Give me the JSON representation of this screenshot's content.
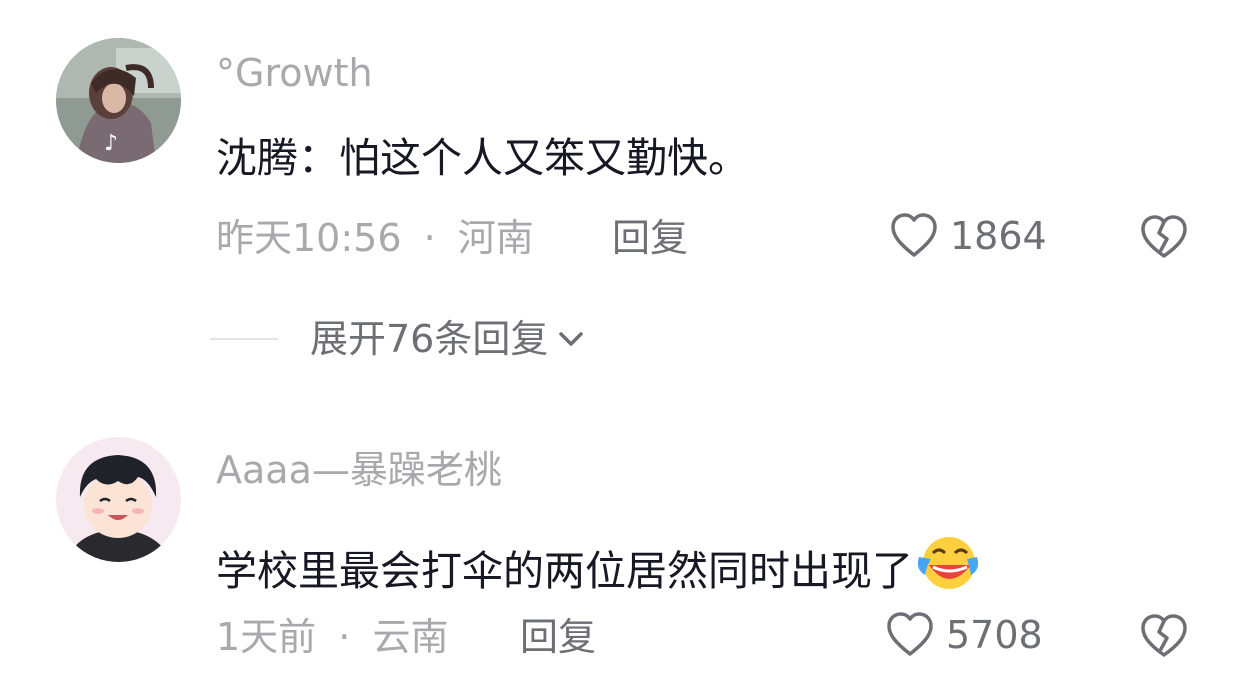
{
  "comments": [
    {
      "username": "°Growth",
      "text": "沈腾：怕这个人又笨又勤快。",
      "time": "昨天10:56",
      "separator": "·",
      "location": "河南",
      "reply_label": "回复",
      "likes": "1864",
      "expand_label": "展开76条回复"
    },
    {
      "username": "Aaaa—暴躁老桃",
      "text": "学校里最会打伞的两位居然同时出现了",
      "emoji_name": "laughing-crying-emoji",
      "time": "1天前",
      "separator": "·",
      "location": "云南",
      "reply_label": "回复",
      "likes": "5708"
    }
  ],
  "icons": {
    "like": "heart-outline-icon",
    "dislike": "broken-heart-icon",
    "expand": "chevron-down-icon"
  },
  "colors": {
    "primary_text": "#161823",
    "secondary_text": "#a9a9ad",
    "action_text": "#6e6f75",
    "icon": "#6e6f75"
  }
}
